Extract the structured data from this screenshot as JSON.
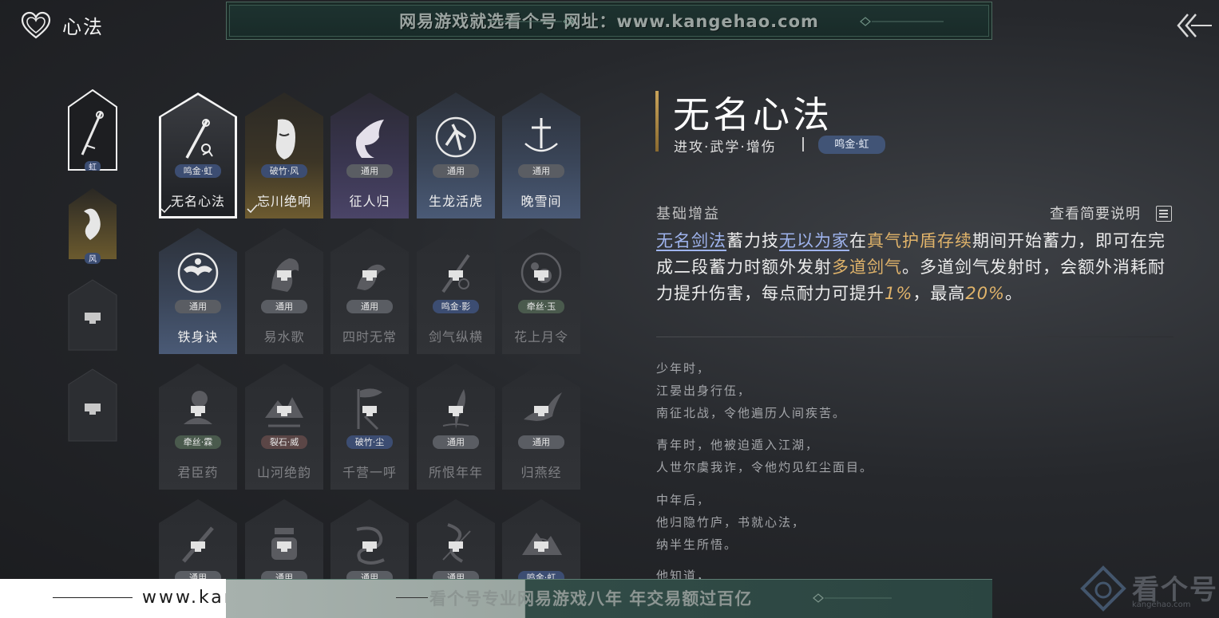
{
  "header": {
    "title": "心法",
    "icon": "heart-icon",
    "back_icon": "back-arrow-icon"
  },
  "top_banner": {
    "text": "网易游戏就选看个号 网址：www.kangehao.com"
  },
  "left_rail": [
    {
      "label": "虹",
      "state": "selected"
    },
    {
      "label": "风",
      "state": "unlocked"
    },
    {
      "label": "",
      "state": "locked"
    },
    {
      "label": "",
      "state": "locked"
    }
  ],
  "grid": [
    {
      "name": "无名心法",
      "tag": "鸣金·虹",
      "tag_color": "blue",
      "state": "selected",
      "equipped": true,
      "icon": "sword-icon"
    },
    {
      "name": "忘川绝响",
      "tag": "破竹·风",
      "tag_color": "blue",
      "state": "gold",
      "equipped": true,
      "icon": "mask-icon"
    },
    {
      "name": "征人归",
      "tag": "通用",
      "tag_color": "gray",
      "state": "purple",
      "equipped": false,
      "icon": "bird-icon"
    },
    {
      "name": "生龙活虎",
      "tag": "通用",
      "tag_color": "gray",
      "state": "blue",
      "equipped": false,
      "icon": "runner-icon"
    },
    {
      "name": "晚雪间",
      "tag": "通用",
      "tag_color": "gray",
      "state": "blue",
      "equipped": false,
      "icon": "cross-icon"
    },
    {
      "name": "铁身诀",
      "tag": "通用",
      "tag_color": "gray",
      "state": "blue",
      "equipped": false,
      "icon": "muscle-icon"
    },
    {
      "name": "易水歌",
      "tag": "通用",
      "tag_color": "gray",
      "state": "locked",
      "equipped": false,
      "icon": "horse-icon"
    },
    {
      "name": "四时无常",
      "tag": "通用",
      "tag_color": "gray",
      "state": "locked",
      "equipped": false,
      "icon": "figure-icon"
    },
    {
      "name": "剑气纵横",
      "tag": "鸣金·影",
      "tag_color": "blue",
      "state": "locked",
      "equipped": false,
      "icon": "blade-icon"
    },
    {
      "name": "花上月令",
      "tag": "牵丝·玉",
      "tag_color": "green",
      "state": "locked",
      "equipped": false,
      "icon": "flower-icon"
    },
    {
      "name": "君臣药",
      "tag": "牵丝·霖",
      "tag_color": "green",
      "state": "locked",
      "equipped": false,
      "icon": "gourd-icon"
    },
    {
      "name": "山河绝韵",
      "tag": "裂石·威",
      "tag_color": "red",
      "state": "locked",
      "equipped": false,
      "icon": "mountain-icon"
    },
    {
      "name": "千营一呼",
      "tag": "破竹·尘",
      "tag_color": "blue",
      "state": "locked",
      "equipped": false,
      "icon": "flag-icon"
    },
    {
      "name": "所恨年年",
      "tag": "通用",
      "tag_color": "gray",
      "state": "locked",
      "equipped": false,
      "icon": "leaf-icon"
    },
    {
      "name": "归燕经",
      "tag": "通用",
      "tag_color": "gray",
      "state": "locked",
      "equipped": false,
      "icon": "swallow-icon"
    },
    {
      "name": "",
      "tag": "通用",
      "tag_color": "gray",
      "state": "locked",
      "equipped": false,
      "icon": "knife-icon"
    },
    {
      "name": "",
      "tag": "通用",
      "tag_color": "gray",
      "state": "locked",
      "equipped": false,
      "icon": "armor-icon"
    },
    {
      "name": "",
      "tag": "通用",
      "tag_color": "gray",
      "state": "locked",
      "equipped": false,
      "icon": "dragon-icon"
    },
    {
      "name": "",
      "tag": "通用",
      "tag_color": "gray",
      "state": "locked",
      "equipped": false,
      "icon": "snake-icon"
    },
    {
      "name": "",
      "tag": "鸣金·虹",
      "tag_color": "blue",
      "state": "locked",
      "equipped": false,
      "icon": "peak-icon"
    }
  ],
  "detail": {
    "title": "无名心法",
    "subtitle": "进攻·武学·增伤",
    "tag": "鸣金·虹",
    "section_label": "基础增益",
    "summary_link": "查看简要说明",
    "desc": {
      "s1": "无名剑法",
      "t1": "蓄力技",
      "s2": "无以为家",
      "t2": "在",
      "s3": "真气护盾存续",
      "t3": "期间开始蓄力，即可在完成二段蓄力时额外发射",
      "s4": "多道剑气",
      "t4": "。多道剑气发射时，会额外消耗耐力提升伤害，每点耐力可提升",
      "s5": "1%",
      "t5": "，最高",
      "s6": "20%",
      "t6": "。"
    },
    "lore": [
      "少年时，",
      "江晏出身行伍，",
      "南征北战，令他遍历人间疾苦。",
      "青年时，他被迫遁入江湖，",
      "人世尔虞我诈，令他灼见红尘面目。",
      "中年后，",
      "他归隐竹庐，书就心法，",
      "纳半生所悟。",
      "他知道，"
    ]
  },
  "footer": {
    "url": "www.kangehao.com",
    "banner_text": "看个号专业网易游戏八年 年交易额过百亿",
    "watermark_name": "看个号",
    "watermark_url": "kangehao.com"
  }
}
